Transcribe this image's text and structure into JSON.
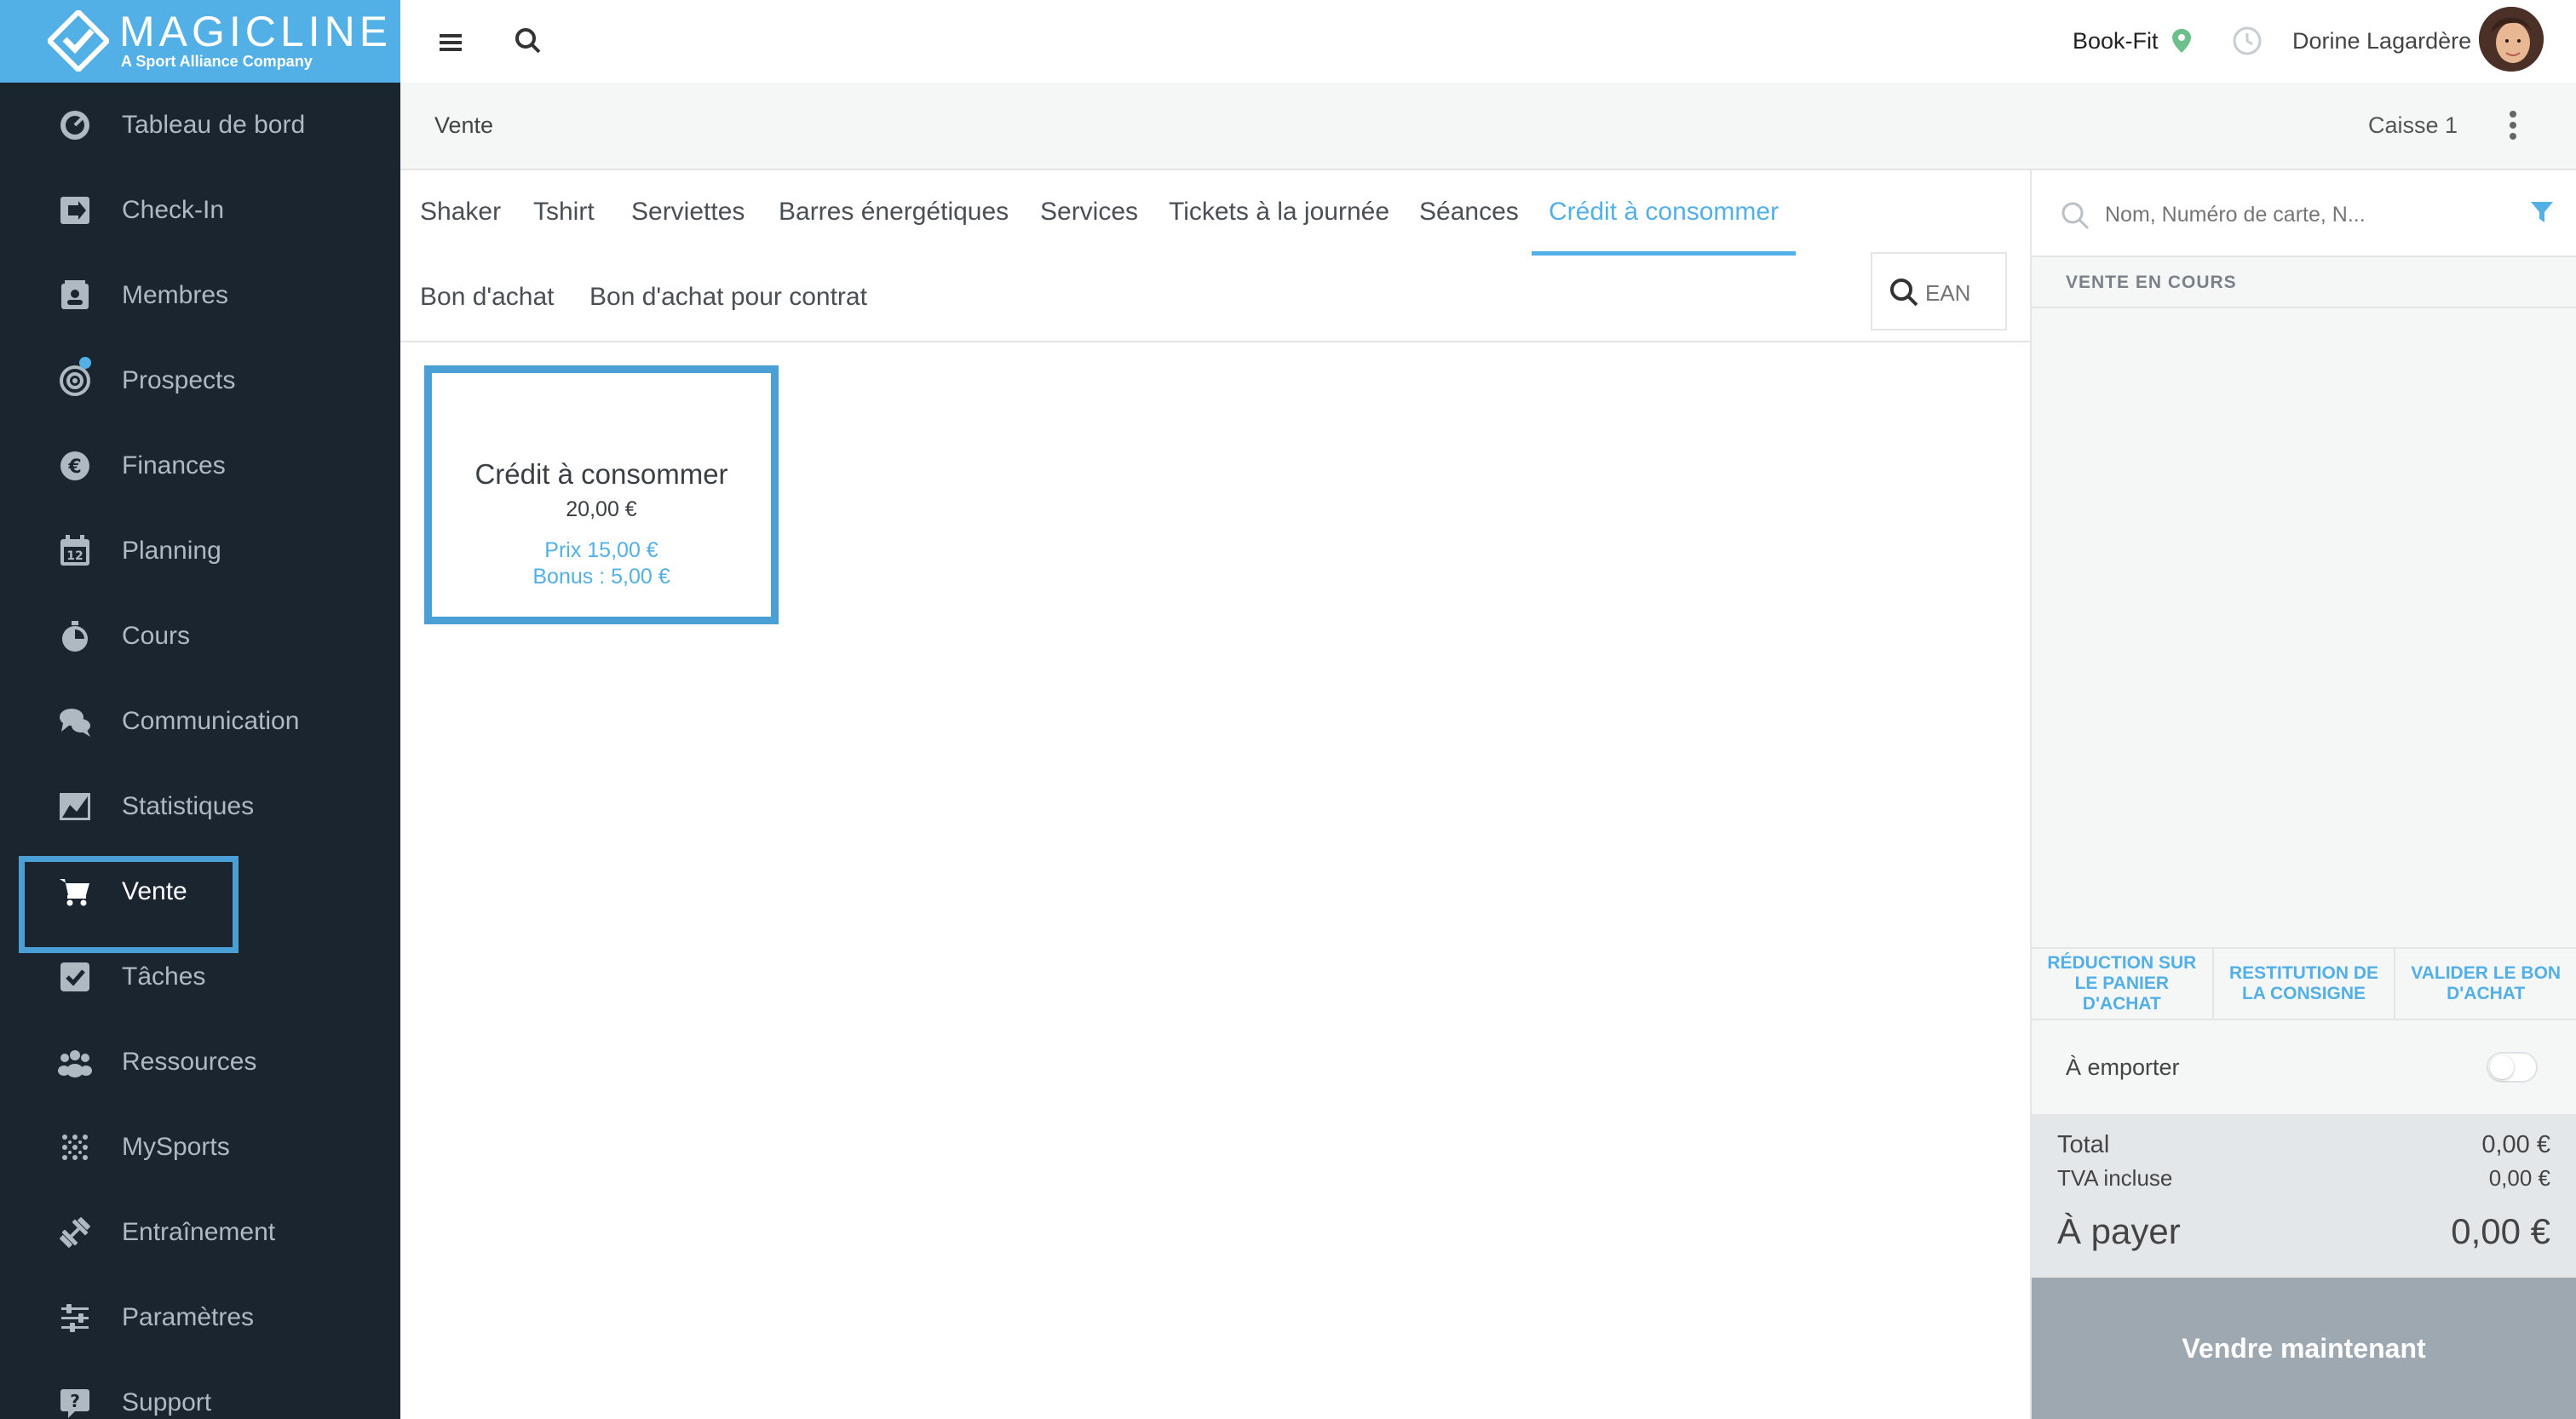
{
  "brand": {
    "name": "MAGICLINE",
    "tagline": "A Sport Alliance Company",
    "accent": "#52b0e6"
  },
  "sidebar": {
    "items": [
      {
        "label": "Tableau de bord",
        "icon": "dashboard-icon"
      },
      {
        "label": "Check-In",
        "icon": "check-in-icon"
      },
      {
        "label": "Membres",
        "icon": "members-icon"
      },
      {
        "label": "Prospects",
        "icon": "prospects-icon"
      },
      {
        "label": "Finances",
        "icon": "euro-icon"
      },
      {
        "label": "Planning",
        "icon": "calendar-icon"
      },
      {
        "label": "Cours",
        "icon": "stopwatch-icon"
      },
      {
        "label": "Communication",
        "icon": "chat-icon"
      },
      {
        "label": "Statistiques",
        "icon": "chart-icon"
      },
      {
        "label": "Vente",
        "icon": "cart-icon",
        "active": true
      },
      {
        "label": "Tâches",
        "icon": "checkbox-icon"
      },
      {
        "label": "Ressources",
        "icon": "people-icon"
      },
      {
        "label": "MySports",
        "icon": "dots-grid-icon"
      },
      {
        "label": "Entraînement",
        "icon": "dumbbell-icon"
      },
      {
        "label": "Paramètres",
        "icon": "sliders-icon"
      },
      {
        "label": "Support",
        "icon": "support-icon"
      }
    ]
  },
  "topbar": {
    "club": "Book-Fit",
    "user": "Dorine Lagardère"
  },
  "subheader": {
    "title": "Vente",
    "register": "Caisse 1"
  },
  "tabs": {
    "row1": [
      "Shaker",
      "Tshirt",
      "Serviettes",
      "Barres énergétiques",
      "Services",
      "Tickets à la journée",
      "Séances",
      "Crédit à consommer"
    ],
    "row2": [
      "Bon d'achat",
      "Bon d'achat pour contrat"
    ],
    "active": "Crédit à consommer",
    "ean_placeholder": "EAN"
  },
  "products": [
    {
      "name": "Crédit à consommer",
      "value": "20,00 €",
      "price": "Prix 15,00 €",
      "bonus": "Bonus : 5,00 €"
    }
  ],
  "cart": {
    "search_placeholder": "Nom, Numéro de carte, N...",
    "section_title": "VENTE EN COURS",
    "actions": [
      "RÉDUCTION SUR LE PANIER D'ACHAT",
      "RESTITUTION DE LA CONSIGNE",
      "VALIDER LE BON D'ACHAT"
    ],
    "takeaway_label": "À emporter",
    "takeaway_on": false,
    "total_label": "Total",
    "total_value": "0,00 €",
    "vat_label": "TVA incluse",
    "vat_value": "0,00 €",
    "pay_label": "À payer",
    "pay_value": "0,00 €",
    "sell_button": "Vendre maintenant"
  }
}
